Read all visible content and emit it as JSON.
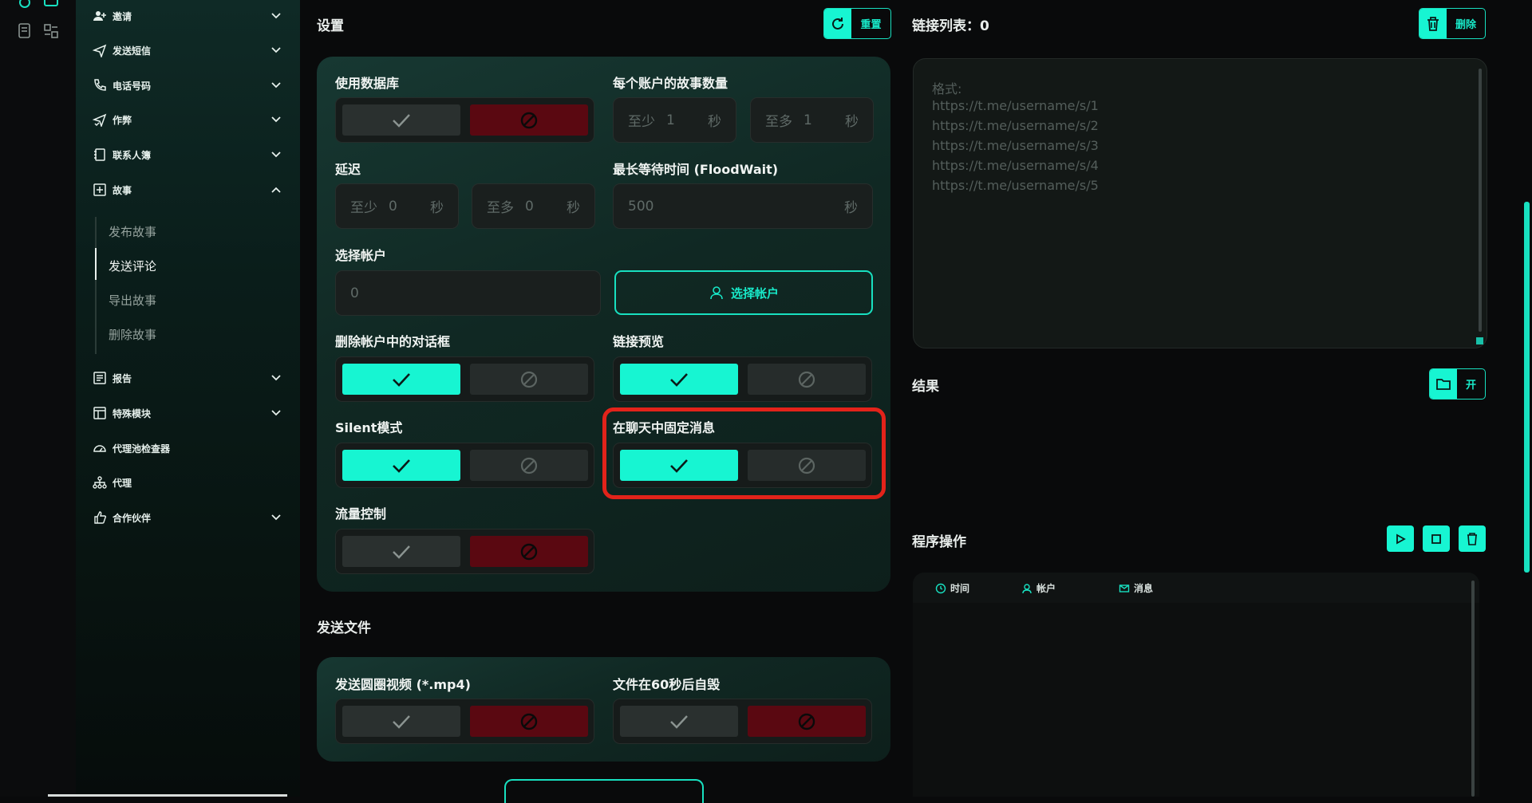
{
  "sidebar": {
    "items": [
      {
        "label": "邀请",
        "icon": "user-plus-icon"
      },
      {
        "label": "发送短信",
        "icon": "send-icon"
      },
      {
        "label": "电话号码",
        "icon": "phone-icon"
      },
      {
        "label": "作弊",
        "icon": "send-check-icon"
      },
      {
        "label": "联系人簿",
        "icon": "book-icon"
      },
      {
        "label": "故事",
        "icon": "plus-square-icon"
      },
      {
        "label": "报告",
        "icon": "report-icon"
      },
      {
        "label": "特殊模块",
        "icon": "module-icon"
      },
      {
        "label": "代理池检查器",
        "icon": "gauge-icon"
      },
      {
        "label": "代理",
        "icon": "network-icon"
      },
      {
        "label": "合作伙伴",
        "icon": "thumb-up-icon"
      }
    ],
    "story_sub": [
      "发布故事",
      "发送评论",
      "导出故事",
      "删除故事"
    ],
    "active_sub": "发送评论"
  },
  "settings": {
    "title": "设置",
    "reset_label": "重置",
    "use_db_label": "使用数据库",
    "stories_per_account_label": "每个账户的故事数量",
    "min_prefix": "至少",
    "max_prefix": "至多",
    "stories_min": "1",
    "stories_max": "1",
    "sec_suffix": "秒",
    "delay_label": "延迟",
    "delay_min": "0",
    "delay_max": "0",
    "floodwait_label": "最长等待时间 (FloodWait)",
    "floodwait_value": "500",
    "select_accounts_label": "选择帐户",
    "accounts_count": "0",
    "select_accounts_button": "选择帐户",
    "delete_dialogs_label": "删除帐户中的对话框",
    "link_preview_label": "链接预览",
    "silent_label": "Silent模式",
    "pin_label": "在聊天中固定消息",
    "traffic_label": "流量控制"
  },
  "send_files": {
    "title": "发送文件",
    "round_video_label": "发送圆圈视频 (*.mp4)",
    "self_destruct_label": "文件在60秒后自毁"
  },
  "links": {
    "title": "链接列表：0",
    "delete_label": "删除",
    "placeholder_lines": [
      "格式:",
      "https://t.me/username/s/1",
      "https://t.me/username/s/2",
      "https://t.me/username/s/3",
      "https://t.me/username/s/4",
      "https://t.me/username/s/5"
    ]
  },
  "result": {
    "title": "结果",
    "open_label": "开"
  },
  "ops": {
    "title": "程序操作",
    "columns": [
      {
        "label": "时间",
        "icon": "clock-icon"
      },
      {
        "label": "帐户",
        "icon": "user-icon"
      },
      {
        "label": "消息",
        "icon": "mail-icon"
      }
    ]
  },
  "colors": {
    "accent": "#17f5d2",
    "danger": "#5a0811",
    "highlight": "#e2231a"
  }
}
